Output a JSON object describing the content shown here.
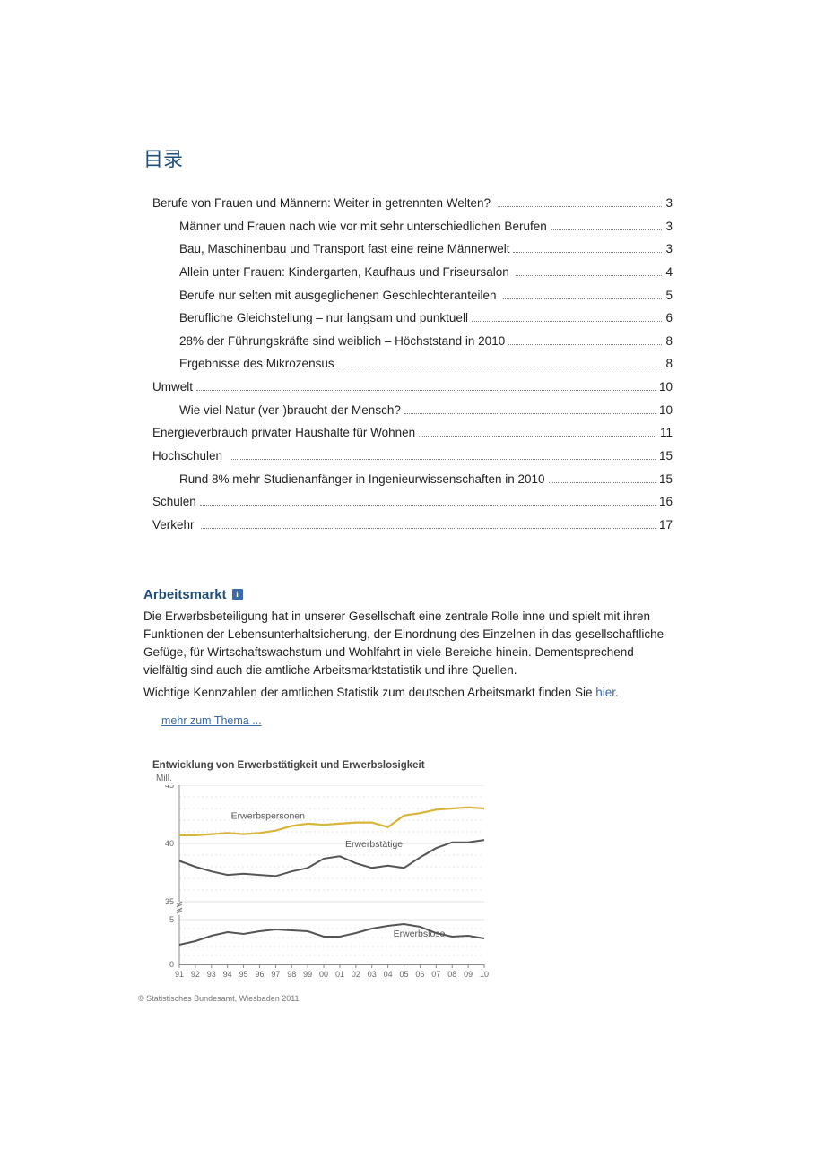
{
  "toc_title": "目录",
  "toc": [
    {
      "level": 1,
      "label": "Berufe von Frauen und Männern: Weiter in getrennten Welten? ",
      "page": "3"
    },
    {
      "level": 2,
      "label": "Männer und Frauen nach wie vor mit sehr unterschiedlichen Berufen",
      "page": "3"
    },
    {
      "level": 2,
      "label": "Bau, Maschinenbau und Transport fast eine reine Männerwelt",
      "page": "3"
    },
    {
      "level": 2,
      "label": "Allein unter Frauen: Kindergarten, Kaufhaus und Friseursalon ",
      "page": "4"
    },
    {
      "level": 2,
      "label": "Berufe nur selten mit ausgeglichenen Geschlechteranteilen ",
      "page": "5"
    },
    {
      "level": 2,
      "label": "Berufliche Gleichstellung – nur langsam und punktuell",
      "page": "6"
    },
    {
      "level": 2,
      "label": "28% der Führungskräfte sind weiblich – Höchststand in 2010",
      "page": "8"
    },
    {
      "level": 2,
      "label": "Ergebnisse des Mikrozensus ",
      "page": "8"
    },
    {
      "level": 1,
      "label": "Umwelt",
      "page": "10"
    },
    {
      "level": 2,
      "label": "Wie viel Natur (ver-)braucht der Mensch?",
      "page": "10"
    },
    {
      "level": 1,
      "label": "Energieverbrauch privater Haushalte für Wohnen",
      "page": "11"
    },
    {
      "level": 1,
      "label": "Hochschulen ",
      "page": "15"
    },
    {
      "level": 2,
      "label": "Rund 8% mehr Studienanfänger in Ingenieurwissenschaften in 2010",
      "page": "15"
    },
    {
      "level": 1,
      "label": "Schulen",
      "page": "16"
    },
    {
      "level": 1,
      "label": "Verkehr ",
      "page": "17"
    }
  ],
  "section": {
    "heading": "Arbeitsmarkt",
    "info_icon": "i",
    "paragraph1": "Die Erwerbsbeteiligung hat in unserer Gesellschaft eine zentrale Rolle inne und spielt mit ihren Funktionen der Lebensunterhaltsicherung, der Einordnung des Einzelnen in das gesellschaftliche Gefüge, für Wirtschaftswachstum und Wohlfahrt in viele Bereiche hinein. Dementsprechend vielfältig sind auch die amtliche Arbeitsmarktstatistik und ihre Quellen.",
    "paragraph2_prefix": "Wichtige Kennzahlen der amtlichen Statistik zum deutschen Arbeitsmarkt finden Sie ",
    "paragraph2_link": "hier",
    "paragraph2_suffix": ".",
    "more_link": "mehr zum Thema ..."
  },
  "chart_data": {
    "type": "line",
    "title": "Entwicklung von Erwerbstätigkeit und Erwerbslosigkeit",
    "y_unit_label": "Mill.",
    "xlabel": "",
    "ylabel": "",
    "y_ticks_upper": [
      35,
      40,
      45
    ],
    "y_ticks_lower": [
      0,
      5
    ],
    "axis_break": true,
    "x_categories": [
      "91",
      "92",
      "93",
      "94",
      "95",
      "96",
      "97",
      "98",
      "99",
      "00",
      "01",
      "02",
      "03",
      "04",
      "05",
      "06",
      "07",
      "08",
      "09",
      "10"
    ],
    "series": [
      {
        "name": "Erwerbspersonen",
        "panel": "upper",
        "color": "#d8b43a",
        "values": [
          40.7,
          40.7,
          40.8,
          40.9,
          40.8,
          40.9,
          41.1,
          41.5,
          41.7,
          41.6,
          41.7,
          41.8,
          41.8,
          41.4,
          42.4,
          42.6,
          42.9,
          43.0,
          43.1,
          43.0
        ]
      },
      {
        "name": "Erwerbstätige",
        "panel": "upper",
        "color": "#555555",
        "values": [
          38.5,
          38.0,
          37.6,
          37.3,
          37.4,
          37.3,
          37.2,
          37.6,
          37.9,
          38.7,
          38.9,
          38.3,
          37.9,
          38.1,
          37.9,
          38.8,
          39.6,
          40.1,
          40.1,
          40.3
        ]
      },
      {
        "name": "Erwerbslose",
        "panel": "lower",
        "color": "#555555",
        "values": [
          2.2,
          2.6,
          3.2,
          3.6,
          3.4,
          3.7,
          3.9,
          3.8,
          3.7,
          3.1,
          3.1,
          3.5,
          4.0,
          4.3,
          4.5,
          4.2,
          3.5,
          3.1,
          3.2,
          2.9
        ]
      }
    ],
    "annotations": [
      {
        "text": "Erwerbspersonen",
        "series": "Erwerbspersonen"
      },
      {
        "text": "Erwerbstätige",
        "series": "Erwerbstätige"
      },
      {
        "text": "Erwerbslose",
        "series": "Erwerbslose"
      }
    ],
    "footer": "© Statistisches Bundesamt, Wiesbaden 2011"
  }
}
